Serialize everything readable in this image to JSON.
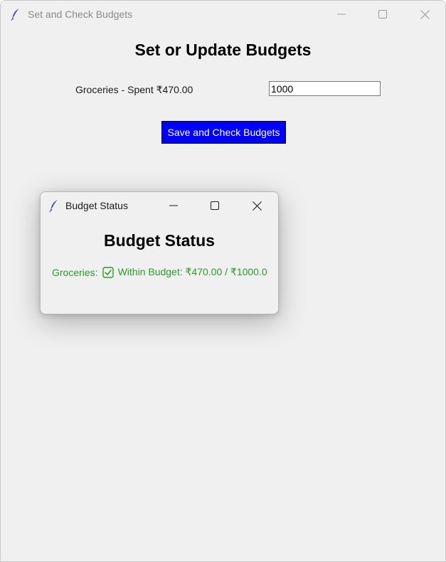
{
  "main_window": {
    "title": "Set and Check Budgets",
    "heading": "Set or Update Budgets",
    "category_label": "Groceries - Spent ₹470.00",
    "budget_value": "1000",
    "save_button_label": "Save and Check Budgets"
  },
  "popup_window": {
    "title": "Budget Status",
    "heading": "Budget Status",
    "status_category": "Groceries:",
    "status_text": "Within Budget: ₹470.00 / ₹1000.0"
  },
  "colors": {
    "window_bg": "#f0f0f0",
    "button_bg": "#0000ff",
    "button_text": "#ffffff",
    "status_green": "#2a9a2a"
  },
  "icons": {
    "app": "feather-icon",
    "minimize": "minimize-icon",
    "maximize": "maximize-icon",
    "close": "close-icon",
    "status": "checkbox-check-icon"
  }
}
